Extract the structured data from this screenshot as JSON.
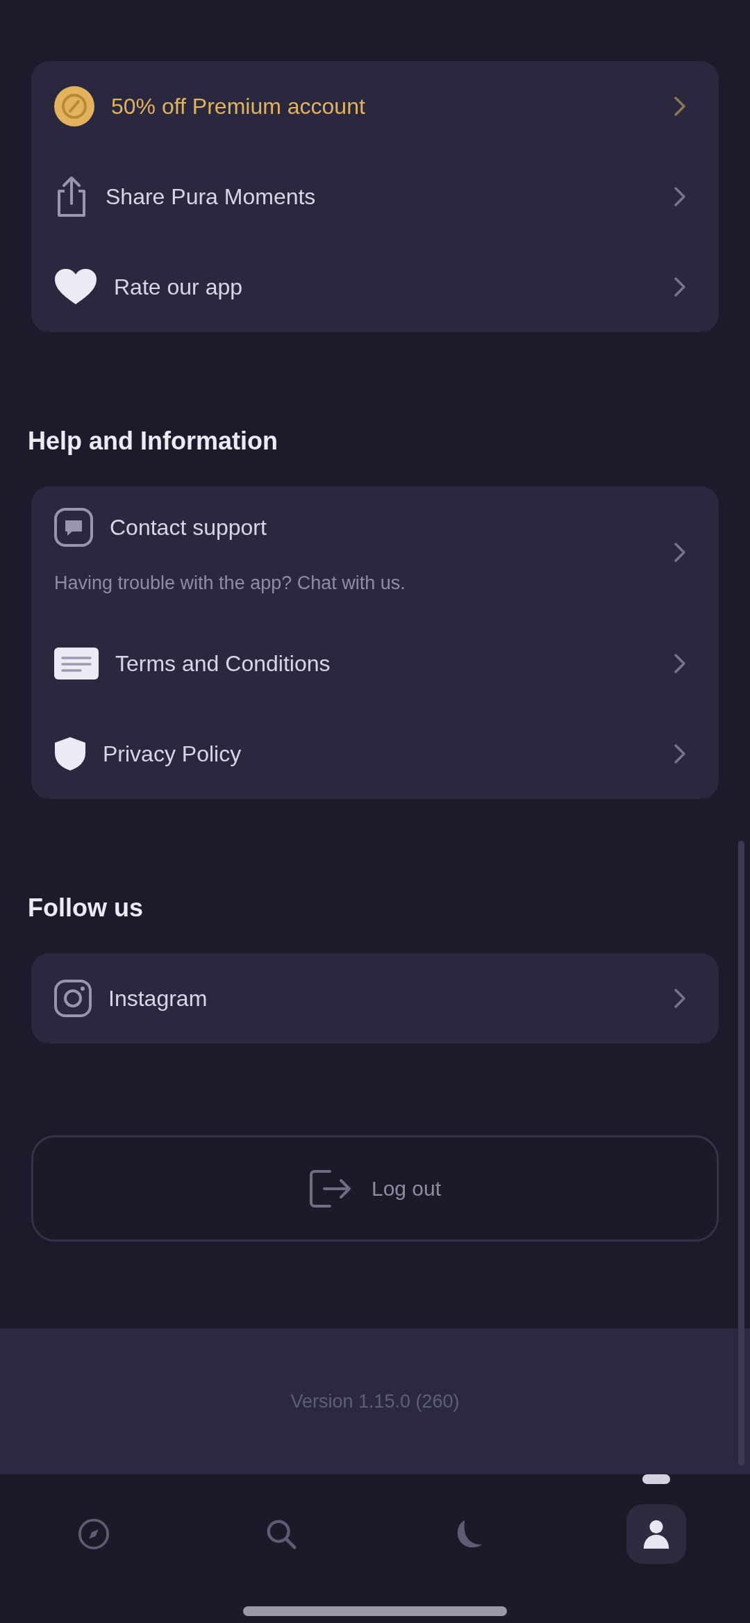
{
  "sections": [
    {
      "items": [
        {
          "kind": "promo",
          "label": "50% off Premium account"
        },
        {
          "kind": "share",
          "label": "Share Pura Moments"
        },
        {
          "kind": "rate",
          "label": "Rate our app"
        }
      ]
    },
    {
      "title": "Help and Information",
      "items": [
        {
          "kind": "support",
          "label": "Contact support",
          "description": "Having trouble with the app? Chat with us."
        },
        {
          "kind": "terms",
          "label": "Terms and Conditions"
        },
        {
          "kind": "privacy",
          "label": "Privacy Policy"
        }
      ]
    },
    {
      "title": "Follow us",
      "items": [
        {
          "kind": "instagram",
          "label": "Instagram"
        }
      ]
    }
  ],
  "logout_button": {
    "label": "Log out"
  },
  "version": "Version 1.15.0 (260)",
  "tab_bar": [
    {
      "kind": "discover",
      "selected": false
    },
    {
      "kind": "search",
      "selected": false
    },
    {
      "kind": "sleep",
      "selected": false
    },
    {
      "kind": "profile",
      "selected": true
    }
  ]
}
